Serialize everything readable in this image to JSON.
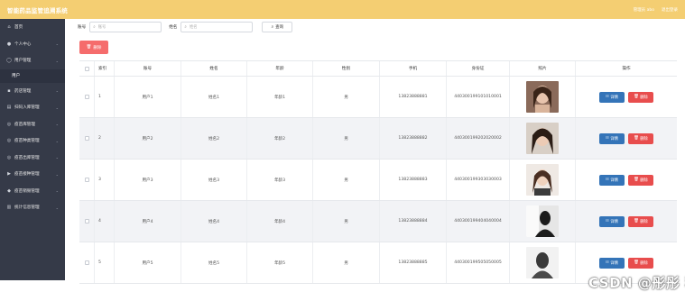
{
  "header": {
    "title": "智能药品监管追溯系统",
    "user_text": "管理员 abo",
    "logout_label": "退出登录"
  },
  "sidebar": {
    "items": [
      {
        "label": "首页",
        "icon": "home-icon",
        "glyph": "⌂"
      },
      {
        "label": "个人中心",
        "icon": "user-icon",
        "glyph": "●"
      },
      {
        "label": "用户管理",
        "icon": "users-icon",
        "glyph": "◯"
      },
      {
        "label": "用户",
        "sub": true
      },
      {
        "label": "药店管理",
        "icon": "store-icon",
        "glyph": "▪"
      },
      {
        "label": "扫码入库管理",
        "icon": "scan-icon",
        "glyph": "▤"
      },
      {
        "label": "疫苗库管理",
        "icon": "box-icon",
        "glyph": "◎"
      },
      {
        "label": "疫苗种类管理",
        "icon": "tag-icon",
        "glyph": "◎"
      },
      {
        "label": "疫苗出库管理",
        "icon": "export-icon",
        "glyph": "◎"
      },
      {
        "label": "疫苗接种管理",
        "icon": "flag-icon",
        "glyph": "▶"
      },
      {
        "label": "疫苗销毁管理",
        "icon": "trash-icon",
        "glyph": "◆"
      },
      {
        "label": "统计信息管理",
        "icon": "stats-icon",
        "glyph": "▥"
      }
    ]
  },
  "search": {
    "account_label": "账号",
    "account_placeholder": "账号",
    "name_label": "姓名",
    "name_placeholder": "姓名",
    "query_label": "查询"
  },
  "toolbar": {
    "delete_label": "删除"
  },
  "table": {
    "headers": [
      "索引",
      "账号",
      "姓名",
      "年龄",
      "性别",
      "手机",
      "身份证",
      "照片",
      "操作"
    ],
    "rows": [
      {
        "index": "1",
        "account": "用户1",
        "name": "姓名1",
        "age": "年龄1",
        "sex": "男",
        "phone": "13823888881",
        "idcard": "440300199101010001"
      },
      {
        "index": "2",
        "account": "用户2",
        "name": "姓名2",
        "age": "年龄2",
        "sex": "男",
        "phone": "13823888882",
        "idcard": "440300199202020002"
      },
      {
        "index": "3",
        "account": "用户3",
        "name": "姓名3",
        "age": "年龄3",
        "sex": "男",
        "phone": "13823888883",
        "idcard": "440300199303030003"
      },
      {
        "index": "4",
        "account": "用户4",
        "name": "姓名4",
        "age": "年龄4",
        "sex": "男",
        "phone": "13823888884",
        "idcard": "440300199404040004"
      },
      {
        "index": "5",
        "account": "用户5",
        "name": "姓名5",
        "age": "年龄5",
        "sex": "男",
        "phone": "13823888885",
        "idcard": "440300199505050005"
      }
    ],
    "detail_label": "详情",
    "delete_label": "删除"
  },
  "watermark": "CSDN @彤彤 程序",
  "colors": {
    "header_bg": "#f4ce72",
    "sidebar_bg": "#353a48",
    "detail_btn": "#3474b8",
    "delete_btn": "#e84d4d"
  }
}
